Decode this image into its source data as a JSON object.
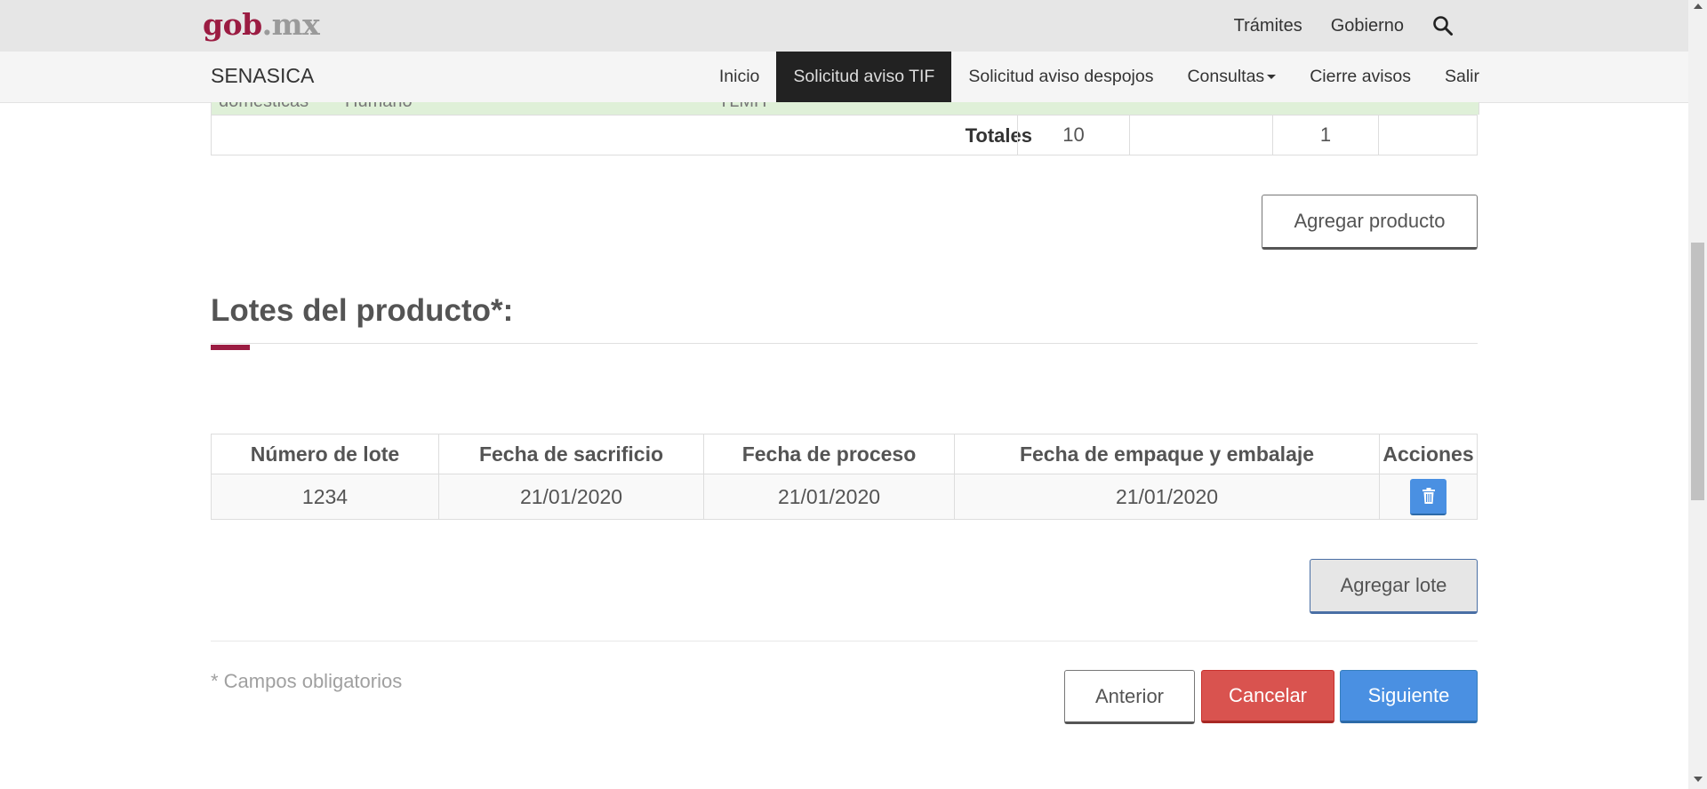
{
  "header": {
    "logo_gob": "gob",
    "logo_mx": ".mx",
    "links": [
      "Trámites",
      "Gobierno"
    ]
  },
  "navbar": {
    "brand": "SENASICA",
    "items": [
      "Inicio",
      "Solicitud aviso TIF",
      "Solicitud aviso despojos",
      "Consultas",
      "Cierre avisos",
      "Salir"
    ],
    "active_index": 1
  },
  "products_table": {
    "partial_row_text": [
      "domésticas",
      "Humano",
      "TLMH"
    ],
    "totals_label": "Totales",
    "totals_values": [
      "10",
      "",
      "1",
      ""
    ],
    "add_product_label": "Agregar producto"
  },
  "lots": {
    "title": "Lotes del producto*:",
    "headers": [
      "Número de lote",
      "Fecha de sacrificio",
      "Fecha de proceso",
      "Fecha de empaque y embalaje",
      "Acciones"
    ],
    "rows": [
      [
        "1234",
        "21/01/2020",
        "21/01/2020",
        "21/01/2020"
      ]
    ],
    "add_lot_label": "Agregar lote"
  },
  "footer": {
    "required_note": "* Campos obligatorios",
    "prev_label": "Anterior",
    "cancel_label": "Cancelar",
    "next_label": "Siguiente"
  },
  "colors": {
    "brand": "#9b1c42",
    "primary": "#4a90e2",
    "danger": "#d9534f",
    "success_row": "#dff0d8"
  }
}
